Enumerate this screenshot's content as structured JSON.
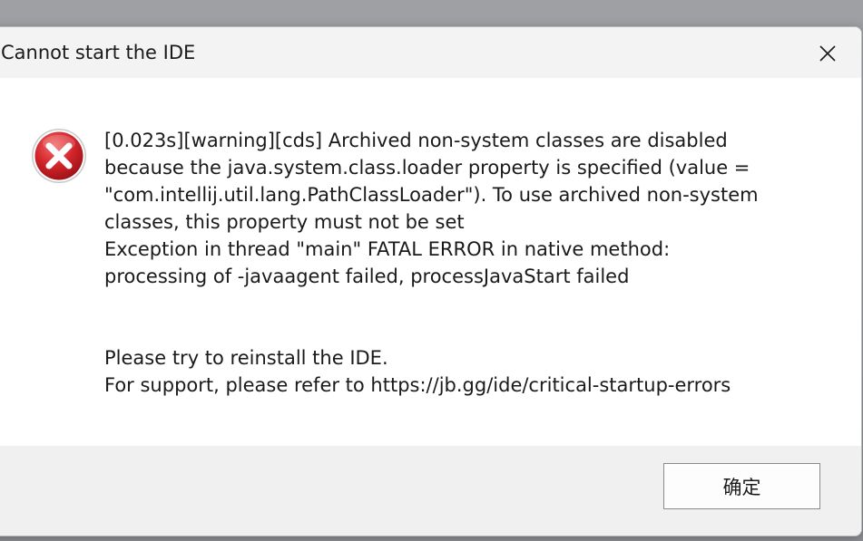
{
  "dialog": {
    "title": "Cannot start the IDE",
    "icon": "error-icon",
    "message_lines": [
      "[0.023s][warning][cds] Archived non-system classes are disabled",
      "because the java.system.class.loader property is specified (value =",
      "\"com.intellij.util.lang.PathClassLoader\"). To use archived non-system",
      "classes, this property must not be set",
      "Exception in thread \"main\" FATAL ERROR in native method:",
      "processing of -javaagent failed, processJavaStart failed"
    ],
    "help_lines": [
      "Please try to reinstall the IDE.",
      "For support, please refer to https://jb.gg/ide/critical-startup-errors"
    ],
    "ok_label": "确定",
    "close_icon": "close-icon"
  },
  "colors": {
    "error_red": "#d2232a",
    "titlebar_bg": "#f3f3f3",
    "footer_bg": "#f0f0f0"
  }
}
